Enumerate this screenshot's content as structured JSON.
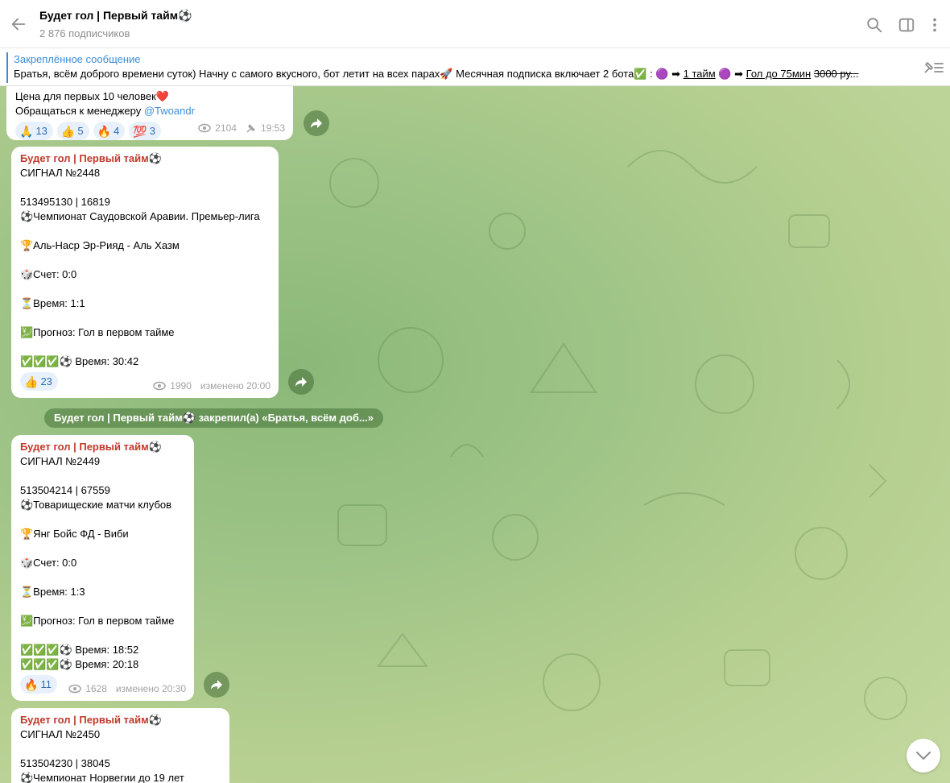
{
  "header": {
    "channel_title": "Будет гол | Первый тайм⚽",
    "subscribers": "2 876 подписчиков"
  },
  "pinned": {
    "label": "Закреплённое сообщение",
    "text_start": "Братья, всём доброго времени  суток)  Начну с самого вкусного, бот летит на всех парах🚀 Месячная подписка включает 2 бота✅ :  🟣 ➡ ",
    "link1": "1 тайм",
    "text_mid": "  🟣 ➡ ",
    "link2": "Гол до 75мин",
    "strike": "3000 ру..."
  },
  "messages": [
    {
      "lines": [
        "Цена для первых 10 человек❤️"
      ],
      "contact_prefix": "Обращаться к менеджеру ",
      "contact_link": "@Twoandr",
      "reactions": [
        {
          "emoji": "🙏",
          "count": "13"
        },
        {
          "emoji": "👍",
          "count": "5"
        },
        {
          "emoji": "🔥",
          "count": "4"
        },
        {
          "emoji": "💯",
          "count": "3"
        }
      ],
      "views": "2104",
      "time": "19:53"
    },
    {
      "author": "Будет гол | Первый тайм⚽",
      "signal": "СИГНАЛ №2448",
      "ids": "513495130 | 16819",
      "league": "⚽Чемпионат Саудовской Аравии. Премьер-лига",
      "match": "🏆Аль-Наср Эр-Рияд - Аль Хазм",
      "score": "🎲Счет: 0:0",
      "time_line": "⏳Время: 1:1",
      "forecast": "💹Прогноз: Гол в первом тайме",
      "results": [
        "✅✅✅⚽ Время: 30:42"
      ],
      "reactions": [
        {
          "emoji": "👍",
          "count": "23"
        }
      ],
      "views": "1990",
      "edited": "изменено 20:00"
    },
    {
      "author": "Будет гол | Первый тайм⚽",
      "signal": "СИГНАЛ №2449",
      "ids": "513504214 | 67559",
      "league": "⚽Товарищеские матчи клубов",
      "match": "🏆Янг Бойс ФД - Виби",
      "score": "🎲Счет: 0:0",
      "time_line": "⏳Время: 1:3",
      "forecast": "💹Прогноз: Гол в первом тайме",
      "results": [
        "✅✅✅⚽ Время: 18:52",
        "✅✅✅⚽ Время: 20:18"
      ],
      "reactions": [
        {
          "emoji": "🔥",
          "count": "11"
        }
      ],
      "views": "1628",
      "edited": "изменено 20:30"
    },
    {
      "author": "Будет гол | Первый тайм⚽",
      "signal": "СИГНАЛ №2450",
      "ids": "513504230 | 38045",
      "league": "⚽Чемпионат Норвегии до 19 лет"
    }
  ],
  "service_message": "Будет гол | Первый тайм⚽ закрепил(а) «Братья, всём доб...»",
  "icons": [
    "back-arrow-icon",
    "search-icon",
    "sidebar-toggle-icon",
    "more-vertical-icon",
    "pinned-list-icon",
    "views-eye-icon",
    "pin-icon",
    "forward-arrow-icon",
    "chevron-down-icon"
  ]
}
